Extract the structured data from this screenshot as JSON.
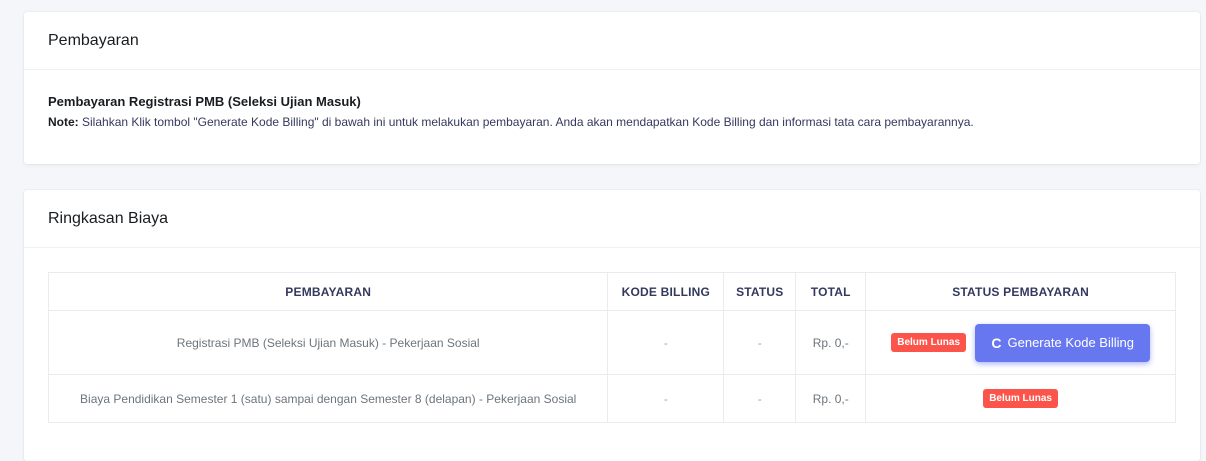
{
  "payment_card": {
    "header": "Pembayaran",
    "title": "Pembayaran Registrasi PMB (Seleksi Ujian Masuk)",
    "note_label": "Note:",
    "note_text": " Silahkan Klik tombol \"Generate Kode Billing\" di bawah ini untuk melakukan pembayaran. Anda akan mendapatkan Kode Billing dan informasi tata cara pembayarannya."
  },
  "summary_card": {
    "header": "Ringkasan Biaya",
    "columns": [
      "PEMBAYARAN",
      "KODE BILLING",
      "STATUS",
      "TOTAL",
      "STATUS PEMBAYARAN"
    ],
    "rows": [
      {
        "pembayaran": "Registrasi PMB (Seleksi Ujian Masuk) - Pekerjaan Sosial",
        "kode_billing": "-",
        "status": "-",
        "total": "Rp. 0,-",
        "badge": "Belum Lunas",
        "button": "Generate Kode Billing",
        "button_icon": "refresh-icon"
      },
      {
        "pembayaran": "Biaya Pendidikan Semester 1 (satu) sampai dengan Semester 8 (delapan) - Pekerjaan Sosial",
        "kode_billing": "-",
        "status": "-",
        "total": "Rp. 0,-",
        "badge": "Belum Lunas"
      }
    ]
  },
  "colors": {
    "badge_danger": "#fc544b",
    "button_primary": "#6777ef",
    "background": "#f4f6f9"
  }
}
